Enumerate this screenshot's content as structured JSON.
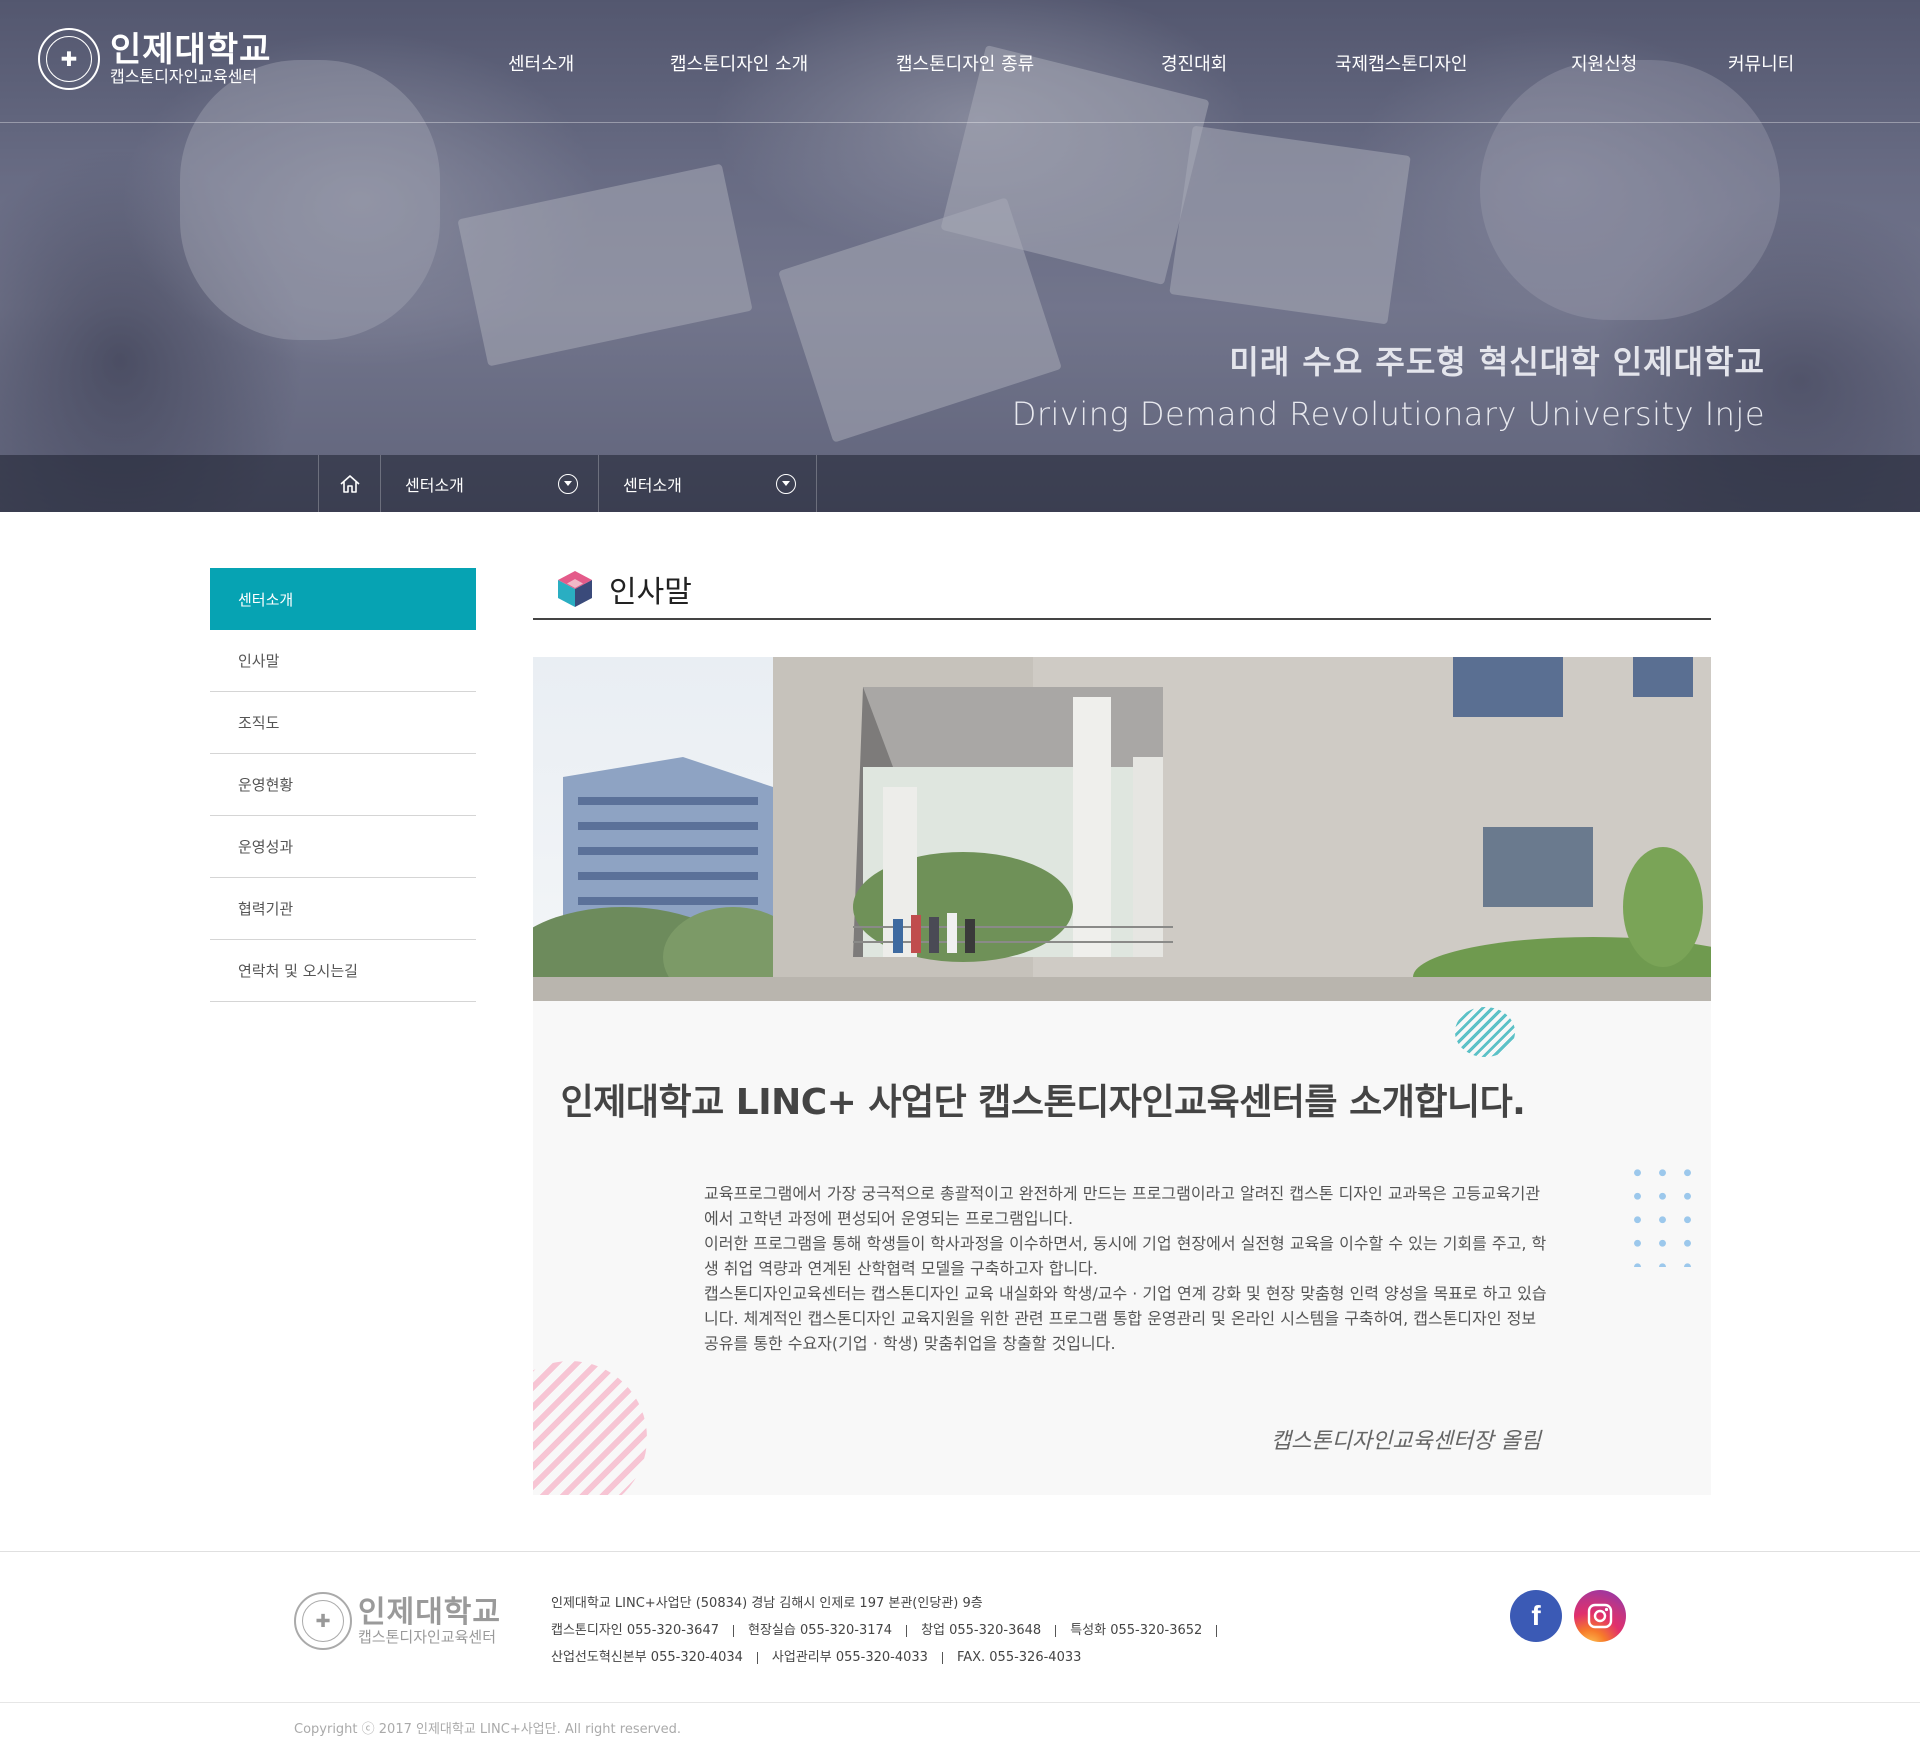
{
  "header": {
    "logo": {
      "title": "인제대학교",
      "subtitle": "캡스톤디자인교육센터"
    },
    "nav": [
      {
        "label": "센터소개"
      },
      {
        "label": "캡스톤디자인 소개"
      },
      {
        "label": "캡스톤디자인 종류"
      },
      {
        "label": "경진대회"
      },
      {
        "label": "국제캡스톤디자인"
      },
      {
        "label": "지원신청"
      },
      {
        "label": "커뮤니티"
      }
    ]
  },
  "hero": {
    "title_ko": "미래 수요 주도형 혁신대학 인제대학교",
    "title_en": "Driving Demand Revolutionary University Inje"
  },
  "location": {
    "home_icon": "home-icon",
    "depth1": "센터소개",
    "depth2": "센터소개"
  },
  "sidebar": {
    "title": "센터소개",
    "items": [
      {
        "label": "인사말"
      },
      {
        "label": "조직도"
      },
      {
        "label": "운영현황"
      },
      {
        "label": "운영성과"
      },
      {
        "label": "협력기관"
      },
      {
        "label": "연락처 및 오시는길"
      }
    ]
  },
  "content": {
    "page_title": "인사말",
    "headline": "인제대학교 LINC+ 사업단 캡스톤디자인교육센터를 소개합니다.",
    "paragraphs": [
      "교육프로그램에서 가장 궁극적으로 총괄적이고 완전하게 만드는 프로그램이라고 알려진 캡스톤 디자인 교과목은 고등교육기관에서 고학년 과정에 편성되어 운영되는 프로그램입니다.",
      "이러한 프로그램을 통해 학생들이 학사과정을 이수하면서, 동시에 기업 현장에서 실전형 교육을 이수할 수 있는 기회를 주고, 학생 취업 역량과 연계된 산학협력 모델을 구축하고자 합니다.",
      "캡스톤디자인교육센터는 캡스톤디자인 교육 내실화와 학생/교수 · 기업 연계 강화 및 현장 맞춤형 인력 양성을 목표로 하고 있습니다. 체계적인 캡스톤디자인 교육지원을 위한 관련 프로그램 통합 운영관리 및 온라인 시스템을 구축하여, 캡스톤디자인 정보공유를 통한 수요자(기업 · 학생) 맞춤취업을 창출할 것입니다."
    ],
    "signature": "캡스톤디자인교육센터장 올림"
  },
  "footer": {
    "logo": {
      "title": "인제대학교",
      "subtitle": "캡스톤디자인교육센터"
    },
    "address": "인제대학교 LINC+사업단 (50834) 경남 김해시 인제로 197 본관(인당관) 9층",
    "contacts_row1": [
      "캡스톤디자인 055-320-3647",
      "현장실습 055-320-3174",
      "창업 055-320-3648",
      "특성화 055-320-3652"
    ],
    "contacts_row2": [
      "산업선도혁신본부 055-320-4034",
      "사업관리부 055-320-4033",
      "FAX. 055-326-4033"
    ],
    "sns": [
      {
        "icon": "facebook-icon",
        "glyph": "f"
      },
      {
        "icon": "instagram-icon"
      }
    ],
    "copyright": "Copyright ⓒ 2017 인제대학교 LINC+사업단. All right reserved."
  },
  "colors": {
    "accent": "#06a3b3",
    "facebook": "#3b5ab5",
    "dots": "#9cc8ec",
    "pink_pattern": "#f7c5d4",
    "teal_pattern": "#5cc1c7"
  }
}
